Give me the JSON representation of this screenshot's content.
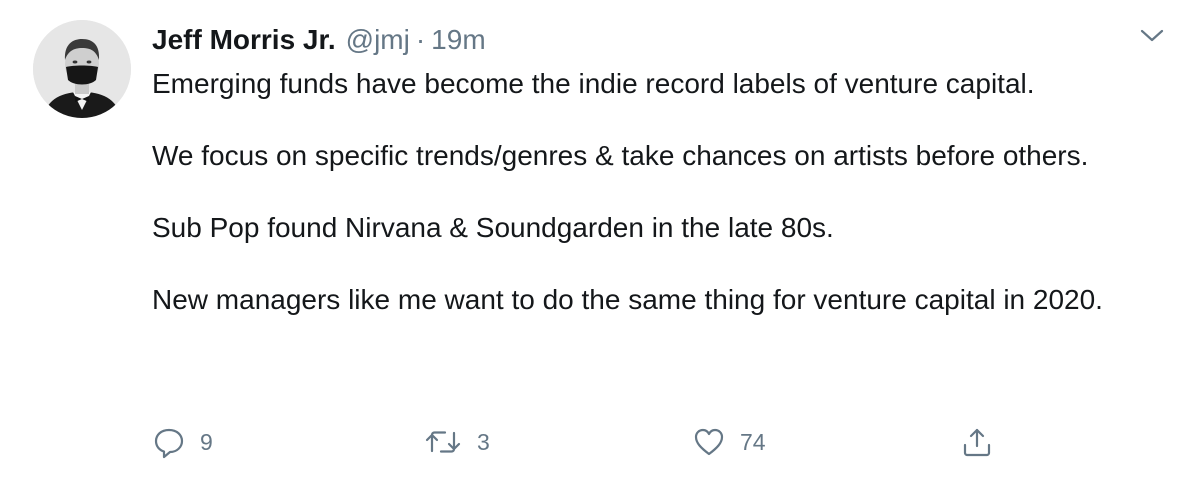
{
  "tweet": {
    "author_name": "Jeff Morris Jr.",
    "handle": "@jmj",
    "separator": "·",
    "time": "19m",
    "paragraphs": [
      "Emerging funds have become the indie record labels of venture capital.",
      "We focus on specific trends/genres & take chances on artists before others.",
      "Sub Pop found Nirvana & Soundgarden in the late 80s.",
      "New managers like me want to do the same thing for venture capital in 2020."
    ]
  },
  "actions": {
    "replies": "9",
    "retweets": "3",
    "likes": "74"
  },
  "icons": {
    "reply": "speech-bubble-icon",
    "retweet": "retweet-arrows-icon",
    "like": "heart-icon",
    "share": "share-upload-icon",
    "menu": "chevron-down-icon"
  },
  "colors": {
    "text": "#14171a",
    "secondary": "#657786",
    "background": "#ffffff"
  }
}
